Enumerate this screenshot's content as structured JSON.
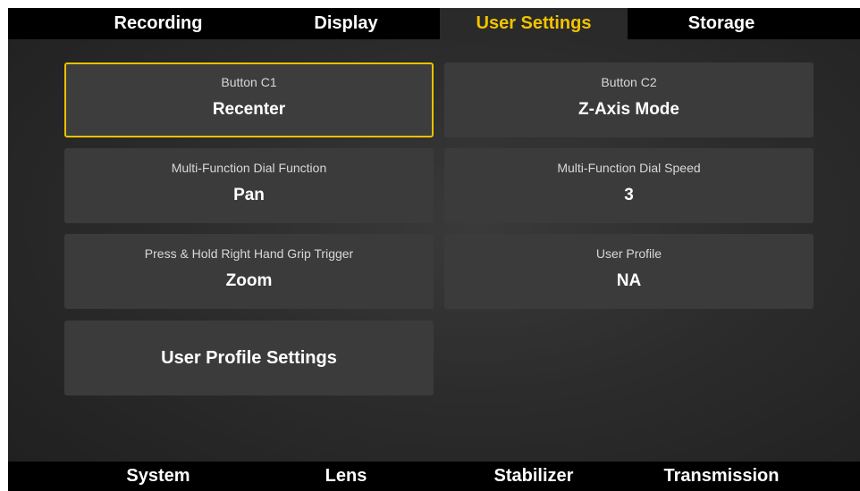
{
  "top_tabs": [
    {
      "label": "Recording",
      "active": false
    },
    {
      "label": "Display",
      "active": false
    },
    {
      "label": "User Settings",
      "active": true
    },
    {
      "label": "Storage",
      "active": false
    }
  ],
  "bottom_tabs": [
    {
      "label": "System"
    },
    {
      "label": "Lens"
    },
    {
      "label": "Stabilizer"
    },
    {
      "label": "Transmission"
    }
  ],
  "settings": {
    "button_c1": {
      "label": "Button C1",
      "value": "Recenter",
      "selected": true
    },
    "button_c2": {
      "label": "Button C2",
      "value": "Z-Axis Mode"
    },
    "dial_function": {
      "label": "Multi-Function Dial Function",
      "value": "Pan"
    },
    "dial_speed": {
      "label": "Multi-Function Dial Speed",
      "value": "3"
    },
    "grip_trigger": {
      "label": "Press & Hold Right Hand Grip Trigger",
      "value": "Zoom"
    },
    "user_profile": {
      "label": "User Profile",
      "value": "NA"
    },
    "user_profile_settings": {
      "label": "User Profile Settings"
    }
  },
  "colors": {
    "accent": "#f2c300",
    "tile": "#3b3b3b",
    "tab_bar": "#000000"
  }
}
